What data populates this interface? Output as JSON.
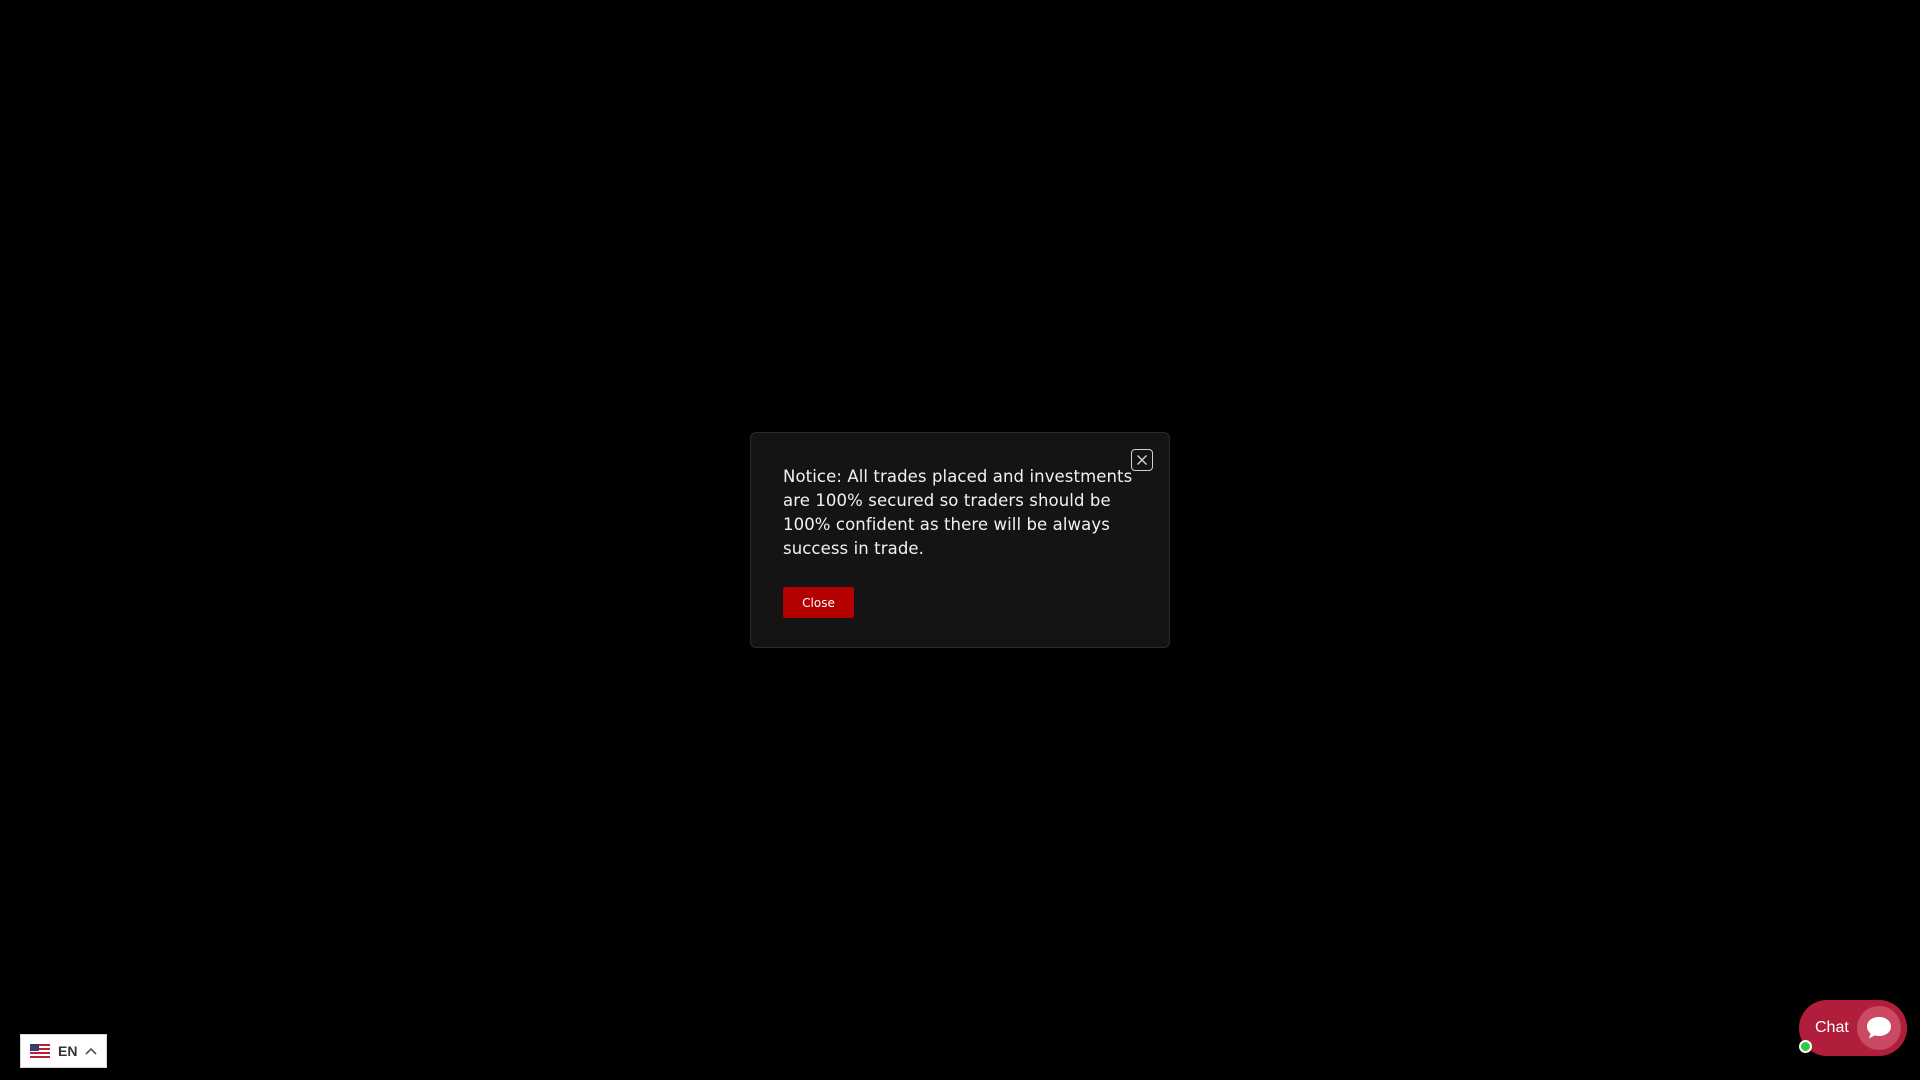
{
  "modal": {
    "notice_text": "Notice: All trades placed and investments are 100% secured so traders should be 100% confident as there will be always success in trade.",
    "close_label": "Close",
    "close_button_color": "#b30000"
  },
  "language": {
    "code": "EN",
    "flag_icon": "us-flag-icon",
    "chevron_icon": "chevron-up-icon"
  },
  "chat": {
    "label": "Chat",
    "icon": "chat-bubble-icon",
    "color": "#b01e3c",
    "status_color": "#2ecc40"
  }
}
